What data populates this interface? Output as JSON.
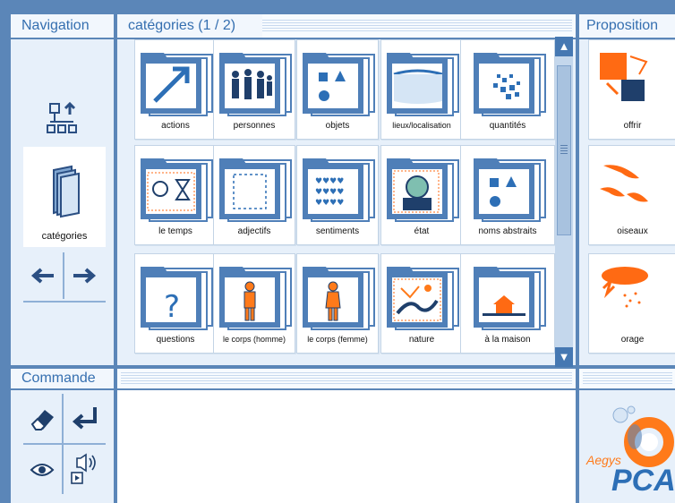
{
  "headers": {
    "navigation": "Navigation",
    "categories": "catégories (1 / 2)",
    "propositions": "Proposition",
    "commande": "Commande"
  },
  "navigation": {
    "tree_icon": "hierarchy-icon",
    "current_label": "catégories",
    "back_icon": "arrow-left-icon",
    "forward_icon": "arrow-right-icon"
  },
  "categories": [
    {
      "label": "actions",
      "icon": "arrow-up-right-icon"
    },
    {
      "label": "personnes",
      "icon": "people-icon"
    },
    {
      "label": "objets",
      "icon": "shapes-icon"
    },
    {
      "label": "lieux/localisation",
      "icon": "place-icon"
    },
    {
      "label": "quantités",
      "icon": "dots-icon"
    },
    {
      "label": "le temps",
      "icon": "clock-hourglass-icon"
    },
    {
      "label": "adjectifs",
      "icon": "dashed-square-icon"
    },
    {
      "label": "sentiments",
      "icon": "hearts-icon"
    },
    {
      "label": "état",
      "icon": "face-icon"
    },
    {
      "label": "noms abstraits",
      "icon": "shapes-icon"
    },
    {
      "label": "questions",
      "icon": "question-mark-icon"
    },
    {
      "label": "le corps (homme)",
      "icon": "man-body-icon"
    },
    {
      "label": "le corps (femme)",
      "icon": "woman-body-icon"
    },
    {
      "label": "nature",
      "icon": "landscape-icon"
    },
    {
      "label": "à la maison",
      "icon": "house-icon"
    }
  ],
  "propositions": [
    {
      "label": "offrir",
      "icon": "give-hands-icon"
    },
    {
      "label": "oiseaux",
      "icon": "birds-icon"
    },
    {
      "label": "orage",
      "icon": "storm-icon"
    }
  ],
  "commande": {
    "erase_icon": "eraser-icon",
    "enter_icon": "return-icon",
    "view_icon": "eye-icon",
    "speak_icon": "speaker-icon"
  },
  "logo": {
    "brand": "Aegys",
    "product": "PCA"
  },
  "colors": {
    "folder": "#4f7fb8",
    "accent": "#ff6a13",
    "frame": "#5b86b8"
  }
}
